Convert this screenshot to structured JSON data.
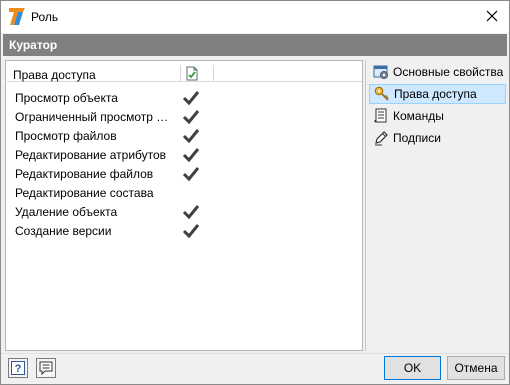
{
  "window": {
    "title": "Роль",
    "icons": {
      "app": "app-logo-icon",
      "close": "close-icon"
    }
  },
  "header": {
    "title": "Куратор"
  },
  "permissions": {
    "column_header": "Права доступа",
    "column_icon": "grant-column-icon",
    "rows": [
      {
        "label": "Просмотр объекта",
        "checked": true
      },
      {
        "label": "Ограниченный просмотр объекта",
        "checked": true
      },
      {
        "label": "Просмотр файлов",
        "checked": true
      },
      {
        "label": "Редактирование атрибутов",
        "checked": true
      },
      {
        "label": "Редактирование файлов",
        "checked": true
      },
      {
        "label": "Редактирование состава",
        "checked": false
      },
      {
        "label": "Удаление объекта",
        "checked": true
      },
      {
        "label": "Создание версии",
        "checked": true
      }
    ]
  },
  "nav": {
    "items": [
      {
        "label": "Основные свойства",
        "icon": "properties-icon",
        "selected": false
      },
      {
        "label": "Права доступа",
        "icon": "key-icon",
        "selected": true
      },
      {
        "label": "Команды",
        "icon": "commands-icon",
        "selected": false
      },
      {
        "label": "Подписи",
        "icon": "pen-icon",
        "selected": false
      }
    ]
  },
  "footer": {
    "help_icon": "help-icon",
    "comment_icon": "comment-icon",
    "ok_label": "OK",
    "cancel_label": "Отмена"
  },
  "colors": {
    "header_bar": "#808080",
    "selection": "#cde8ff",
    "checkmark": "#404040"
  }
}
